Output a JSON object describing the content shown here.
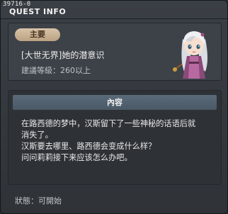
{
  "window": {
    "quest_id": "39716-0",
    "title": "QUEST INFO"
  },
  "quest": {
    "category": "主要",
    "name": "[大世无界]她的潜意识",
    "level_requirement": "建議等級：260以上"
  },
  "content": {
    "header": "內容",
    "lines": [
      "在路西德的梦中，汉斯留下了一些神秘的话语后就",
      "消失了。",
      "汉斯要去哪里、路西德会变成什么样？",
      "问问莉莉接下来应该怎么办吧。"
    ]
  },
  "status": "狀態：可開始",
  "colors": {
    "badge": "#c9b293",
    "content_header": "#52606e",
    "window_bg": "#363a40"
  }
}
